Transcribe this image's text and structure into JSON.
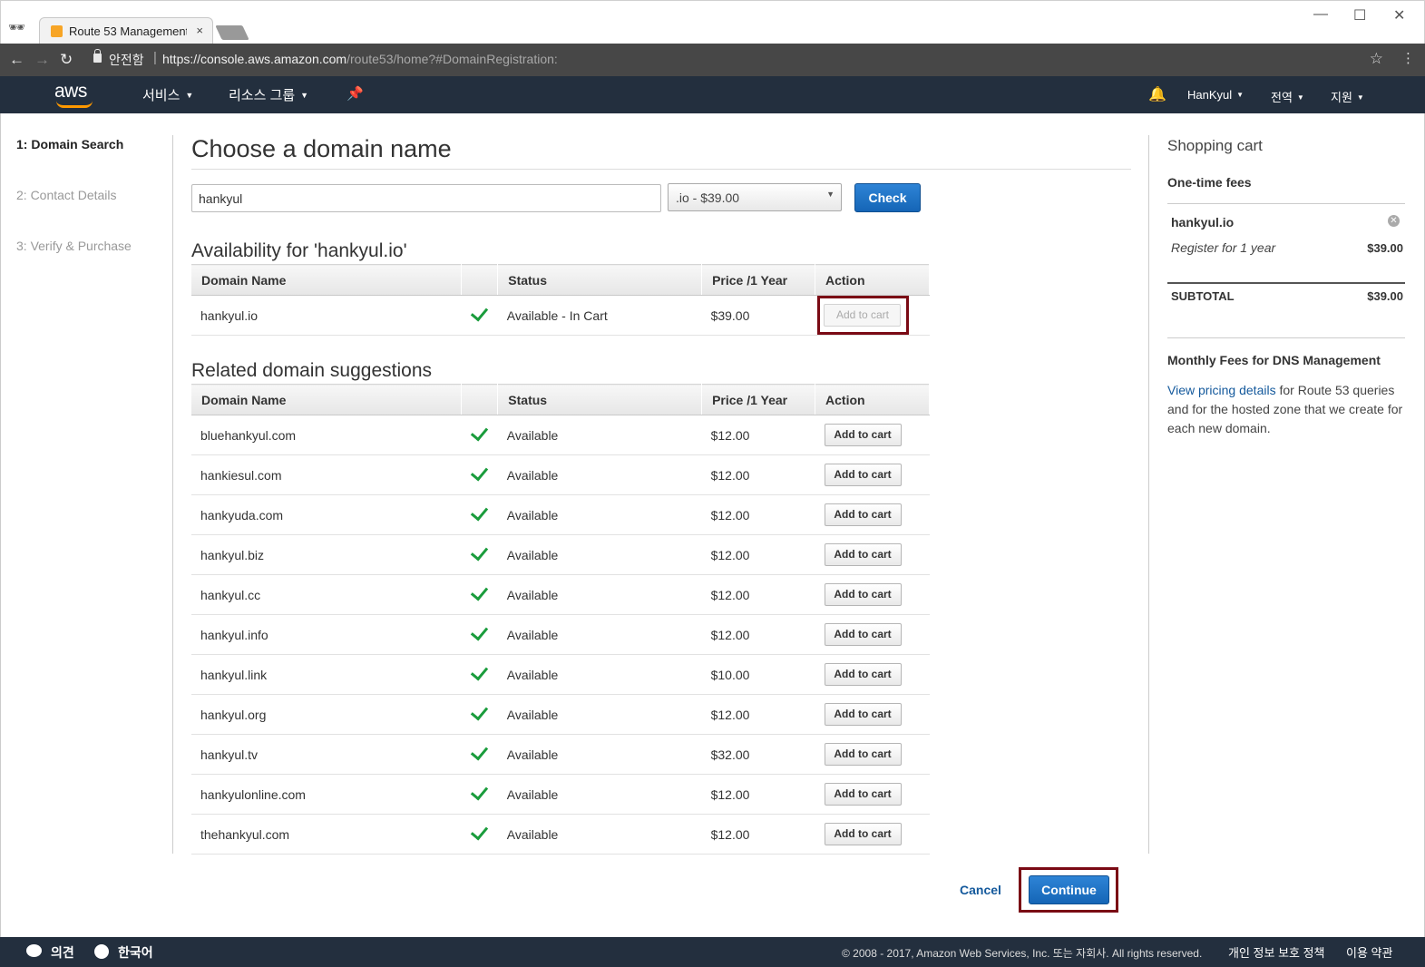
{
  "browser": {
    "tab_title": "Route 53 Management",
    "tab_close": "×",
    "secure_label": "안전함",
    "url_host": "https://console.aws.amazon.com",
    "url_path": "/route53/home?#DomainRegistration:",
    "window_controls": [
      "—",
      "☐",
      "✕"
    ]
  },
  "aws_nav": {
    "logo": "aws",
    "services": "서비스",
    "resource_groups": "리소스 그룹",
    "user": "HanKyul",
    "region": "전역",
    "support": "지원"
  },
  "steps": [
    {
      "label": "1: Domain Search",
      "active": true
    },
    {
      "label": "2: Contact Details",
      "active": false
    },
    {
      "label": "3: Verify & Purchase",
      "active": false
    }
  ],
  "search": {
    "heading": "Choose a domain name",
    "input_value": "hankyul",
    "tld_selected": ".io - $39.00",
    "check_label": "Check"
  },
  "availability": {
    "heading": "Availability for 'hankyul.io'",
    "columns": [
      "Domain Name",
      "",
      "Status",
      "Price /1 Year",
      "Action"
    ],
    "rows": [
      {
        "domain": "hankyul.io",
        "status": "Available - In Cart",
        "price": "$39.00",
        "action": "Add to cart",
        "disabled": true
      }
    ]
  },
  "suggestions": {
    "heading": "Related domain suggestions",
    "columns": [
      "Domain Name",
      "",
      "Status",
      "Price /1 Year",
      "Action"
    ],
    "rows": [
      {
        "domain": "bluehankyul.com",
        "status": "Available",
        "price": "$12.00",
        "action": "Add to cart"
      },
      {
        "domain": "hankiesul.com",
        "status": "Available",
        "price": "$12.00",
        "action": "Add to cart"
      },
      {
        "domain": "hankyuda.com",
        "status": "Available",
        "price": "$12.00",
        "action": "Add to cart"
      },
      {
        "domain": "hankyul.biz",
        "status": "Available",
        "price": "$12.00",
        "action": "Add to cart"
      },
      {
        "domain": "hankyul.cc",
        "status": "Available",
        "price": "$12.00",
        "action": "Add to cart"
      },
      {
        "domain": "hankyul.info",
        "status": "Available",
        "price": "$12.00",
        "action": "Add to cart"
      },
      {
        "domain": "hankyul.link",
        "status": "Available",
        "price": "$10.00",
        "action": "Add to cart"
      },
      {
        "domain": "hankyul.org",
        "status": "Available",
        "price": "$12.00",
        "action": "Add to cart"
      },
      {
        "domain": "hankyul.tv",
        "status": "Available",
        "price": "$32.00",
        "action": "Add to cart"
      },
      {
        "domain": "hankyulonline.com",
        "status": "Available",
        "price": "$12.00",
        "action": "Add to cart"
      },
      {
        "domain": "thehankyul.com",
        "status": "Available",
        "price": "$12.00",
        "action": "Add to cart"
      }
    ]
  },
  "actions": {
    "cancel": "Cancel",
    "continue": "Continue"
  },
  "cart": {
    "title": "Shopping cart",
    "one_time_fees": "One-time fees",
    "item_domain": "hankyul.io",
    "item_term": "Register for 1 year",
    "item_price": "$39.00",
    "subtotal_label": "SUBTOTAL",
    "subtotal_value": "$39.00",
    "dns_title": "Monthly Fees for DNS Management",
    "dns_link": "View pricing details",
    "dns_text": " for Route 53 queries and for the hosted zone that we create for each new domain."
  },
  "footer": {
    "feedback": "의견",
    "language": "한국어",
    "copyright": "© 2008 - 2017, Amazon Web Services, Inc. 또는 자회사. All rights reserved.",
    "privacy": "개인 정보 보호 정책",
    "terms": "이용 약관"
  },
  "colors": {
    "aws_nav_bg": "#232f3e",
    "primary_button": "#1f73c8",
    "highlight_border": "#7a0a14",
    "check_green": "#1a9c3c",
    "link": "#14599c"
  }
}
